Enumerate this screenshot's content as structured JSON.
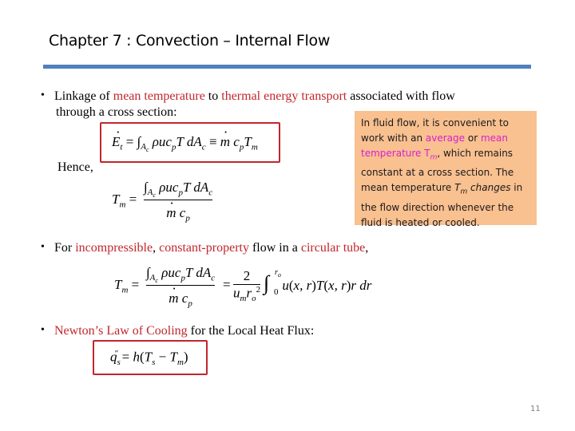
{
  "slide": {
    "title": "Chapter 7  : Convection – Internal Flow",
    "page_number": "11",
    "accent_color": "#4f81bd",
    "highlight_color": "#c0272d"
  },
  "bullets": [
    {
      "marker": "•",
      "parts": [
        {
          "text": "Linkage of ",
          "style": "normal"
        },
        {
          "text": "mean temperature",
          "style": "red"
        },
        {
          "text": " to ",
          "style": "normal"
        },
        {
          "text": "thermal energy transport",
          "style": "red"
        },
        {
          "text": " associated with flow",
          "style": "normal"
        }
      ],
      "continuation": "through a cross section:"
    },
    {
      "marker": "•",
      "parts": [
        {
          "text": "For ",
          "style": "normal"
        },
        {
          "text": "incompressible",
          "style": "red"
        },
        {
          "text": ", ",
          "style": "normal"
        },
        {
          "text": "constant-property",
          "style": "red"
        },
        {
          "text": " flow in a ",
          "style": "normal"
        },
        {
          "text": "circular tube",
          "style": "red"
        },
        {
          "text": ",",
          "style": "normal"
        }
      ]
    },
    {
      "marker": "•",
      "parts": [
        {
          "text": "Newton’s Law of Cooling",
          "style": "red"
        },
        {
          "text": " for the Local Heat Flux:",
          "style": "normal"
        }
      ]
    }
  ],
  "hence_label": "Hence,",
  "equations": {
    "energy_transport": "Ėt = ∫Ac ρucpT dAc ≡ ṁ cpTm",
    "mean_temp_def": "Tm = ∫Ac ρucpT dAc / ṁ cp",
    "mean_temp_tube": "Tm = ∫Ac ρucpT dAc / ṁ cp = 2/(um ro²) ∫0^ro u(x,r) T(x,r) r dr",
    "newton_cooling": "qs″ = h(Ts − Tm)"
  },
  "note": {
    "background": "#f9c090",
    "parts": [
      {
        "text": "In fluid flow, it is convenient to work with an ",
        "style": "normal"
      },
      {
        "text": "average",
        "style": "magenta"
      },
      {
        "text": " or ",
        "style": "normal"
      },
      {
        "text": "mean temperature T",
        "style": "magenta"
      },
      {
        "text": "m",
        "style": "magenta-sub"
      },
      {
        "text": ", which remains constant at a cross section. The mean temperature ",
        "style": "normal"
      },
      {
        "text": "T",
        "style": "italic"
      },
      {
        "text": "m",
        "style": "italic-sub"
      },
      {
        "text": " changes",
        "style": "italic"
      },
      {
        "text": " in the flow direction whenever the fluid is heated or cooled.",
        "style": "normal"
      }
    ]
  }
}
